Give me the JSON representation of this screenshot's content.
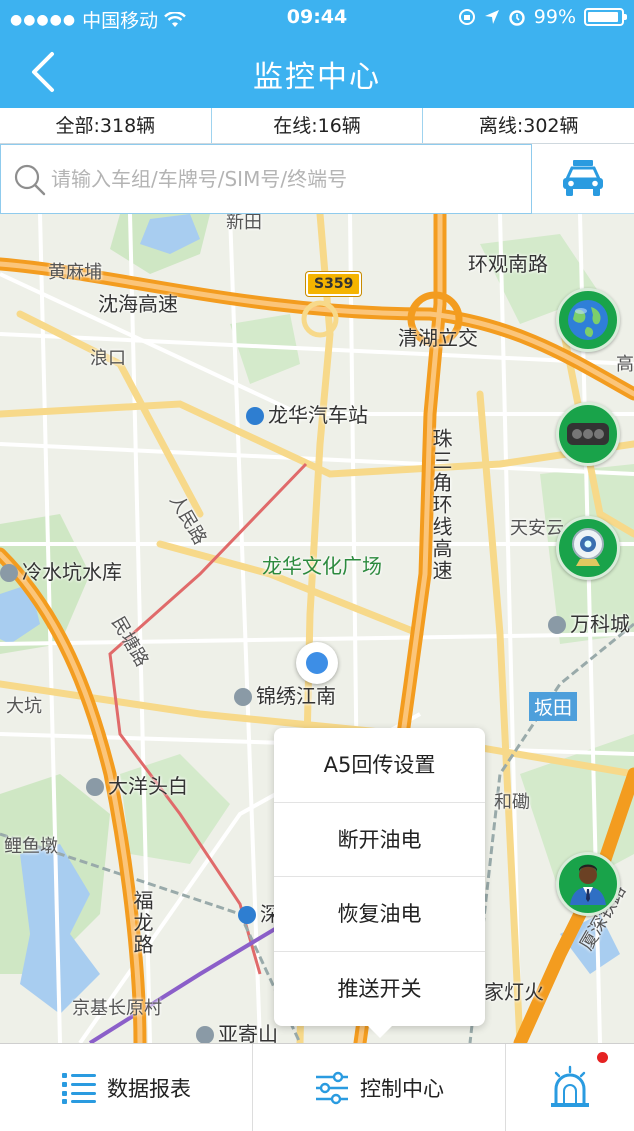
{
  "status_bar": {
    "carrier": "中国移动",
    "time": "09:44",
    "battery_text": "99%"
  },
  "nav": {
    "title": "监控中心",
    "back_icon": "chevron-left-icon"
  },
  "counts": {
    "all": "全部:318辆",
    "online": "在线:16辆",
    "offline": "离线:302辆"
  },
  "search": {
    "placeholder": "请输入车组/车牌号/SIM号/终端号",
    "value": ""
  },
  "map": {
    "road_shield": "S359",
    "labels": {
      "xintian": "新田",
      "huanguan": "环观南路",
      "huangmabu": "黄麻埔",
      "yanhai": "沈海高速",
      "langkou": "浪口",
      "qinghu": "清湖立交",
      "gao": "高",
      "longhua_bus": "龙华汽车站",
      "zhusanjiao": "珠三角环线高速",
      "renmin": "人民路",
      "tianan": "天安云",
      "longhua_plaza": "龙华文化广场",
      "lengshuikeng": "冷水坑水库",
      "wanke": "万科城",
      "mintang": "民塘路",
      "jinxiu": "锦绣江南",
      "dakeng": "大坑",
      "bantian": "坂田",
      "dayang": "大洋头白",
      "hebao": "和磡",
      "liyudun": "鲤鱼墩",
      "fulong": "福龙路",
      "shenzhen_n": "深",
      "jingji": "京基长原村",
      "yajishan": "亚寄山",
      "jiadenghuo": "家灯火",
      "pingyan": "厦深铁路"
    },
    "fab_icons": [
      "globe-icon",
      "traffic-light-icon",
      "camera-icon",
      "driver-icon"
    ]
  },
  "popup_menu": {
    "items": [
      "A5回传设置",
      "断开油电",
      "恢复油电",
      "推送开关"
    ]
  },
  "tabbar": {
    "report": "数据报表",
    "control": "控制中心"
  },
  "colors": {
    "primary": "#3db2f0",
    "fab_green": "#19a34a",
    "highway_orange": "#f39c1f",
    "alert_red": "#e52222"
  }
}
